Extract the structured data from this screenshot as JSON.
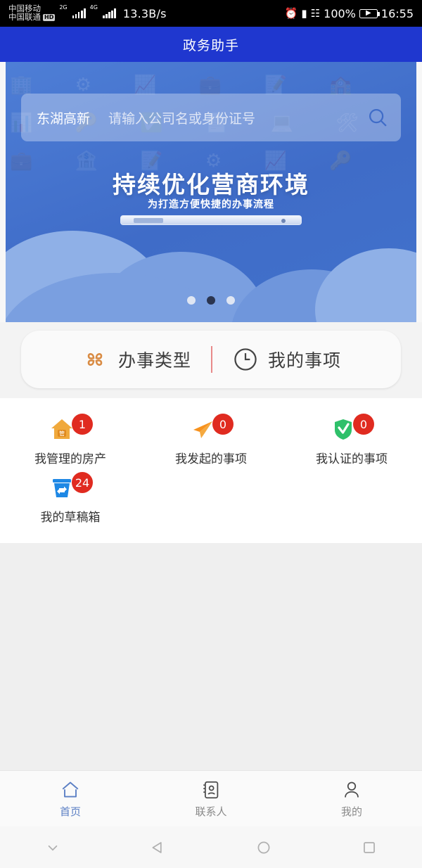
{
  "status_bar": {
    "carrier_1": "中国移动",
    "carrier_2": "中国联通",
    "hd_badge": "HD",
    "signal_1_label": "2G",
    "signal_2_label": "4G",
    "network_speed": "13.3B/s",
    "alarm_icon": "alarm-icon",
    "bluetooth_icon": "bluetooth-icon",
    "vibrate_icon": "vibrate-icon",
    "battery_percent": "100%",
    "battery_icon": "battery-charging-icon",
    "time": "16:55"
  },
  "title_bar": {
    "title": "政务助手",
    "color": "#1f37cf"
  },
  "banner": {
    "search": {
      "location": "东湖高新",
      "placeholder": "请输入公司名或身份证号",
      "icon": "search-icon"
    },
    "headline": "持续优化营商环境",
    "subhead": "为打造方便快捷的办事流程",
    "graphic": "laptop-illustration",
    "carousel": {
      "total": 3,
      "active_index": 1
    }
  },
  "quick_tabs": [
    {
      "label": "办事类型",
      "icon": "clover-icon",
      "color": "#d98b43"
    },
    {
      "label": "我的事项",
      "icon": "clock-icon",
      "color": "#444444"
    }
  ],
  "shortcuts": [
    {
      "label": "我管理的房产",
      "badge": "1",
      "icon": "house-manage-icon",
      "color": "#f0a93c"
    },
    {
      "label": "我发起的事项",
      "badge": "0",
      "icon": "paper-plane-icon",
      "color": "#f7921e"
    },
    {
      "label": "我认证的事项",
      "badge": "0",
      "icon": "shield-check-icon",
      "color": "#2fc06a"
    },
    {
      "label": "我的草稿箱",
      "badge": "24",
      "icon": "recycle-bin-icon",
      "color": "#1e88e5"
    }
  ],
  "badge_color": "#e02b20",
  "bottom_nav": [
    {
      "label": "首页",
      "icon": "home-icon",
      "active": true
    },
    {
      "label": "联系人",
      "icon": "contacts-icon",
      "active": false
    },
    {
      "label": "我的",
      "icon": "person-icon",
      "active": false
    }
  ],
  "android_nav": [
    {
      "icon": "chevron-down-icon"
    },
    {
      "icon": "back-triangle-icon"
    },
    {
      "icon": "home-circle-icon"
    },
    {
      "icon": "recents-square-icon"
    }
  ]
}
